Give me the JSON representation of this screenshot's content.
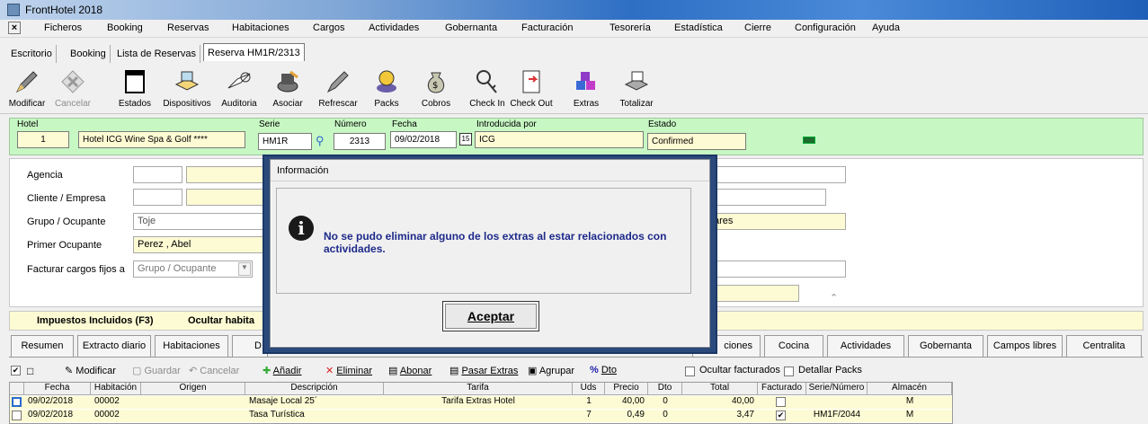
{
  "app": {
    "title": "FrontHotel 2018"
  },
  "menu": [
    "Ficheros",
    "Booking",
    "Reservas",
    "Habitaciones",
    "Cargos",
    "Actividades",
    "Gobernanta",
    "Facturación",
    "Tesorería",
    "Estadística",
    "Cierre",
    "Configuración",
    "Ayuda"
  ],
  "nav_tabs": [
    "Escritorio",
    "Booking",
    "Lista de Reservas",
    "Reserva HM1R/2313"
  ],
  "toolbar": [
    {
      "label": "Modificar",
      "icon": "edit-pencil-icon"
    },
    {
      "label": "Cancelar",
      "icon": "cancel-x-icon"
    },
    {
      "label": "Estados",
      "icon": "window-icon"
    },
    {
      "label": "Dispositivos",
      "icon": "devices-icon"
    },
    {
      "label": "Auditoria",
      "icon": "book-icon"
    },
    {
      "label": "Asociar",
      "icon": "associate-icon"
    },
    {
      "label": "Refrescar",
      "icon": "refresh-icon"
    },
    {
      "label": "Packs",
      "icon": "packs-icon"
    },
    {
      "label": "Cobros",
      "icon": "money-bag-icon"
    },
    {
      "label": "Check In",
      "icon": "key-icon"
    },
    {
      "label": "Check Out",
      "icon": "checkout-icon"
    },
    {
      "label": "Extras",
      "icon": "cubes-icon"
    },
    {
      "label": "Totalizar",
      "icon": "printer-icon"
    }
  ],
  "header": {
    "hotel_label": "Hotel",
    "hotel_code": "1",
    "hotel_name": "Hotel ICG Wine Spa & Golf ****",
    "serie_label": "Serie",
    "serie": "HM1R",
    "numero_label": "Número",
    "numero": "2313",
    "fecha_label": "Fecha",
    "fecha": "09/02/2018",
    "cal_day": "15",
    "introducida_label": "Introducida por",
    "introducida": "ICG",
    "estado_label": "Estado",
    "estado": "Confirmed"
  },
  "form": {
    "agencia_label": "Agencia",
    "cliente_label": "Cliente / Empresa",
    "grupo_label": "Grupo / Ocupante",
    "grupo_value": "Toje",
    "primer_label": "Primer Ocupante",
    "primer_value": "Perez , Abel",
    "facturar_label": "Facturar cargos fijos a",
    "facturar_value": "Grupo / Ocupante",
    "right_value": "ares"
  },
  "section": {
    "impuestos": "Impuestos Incluidos (F3)",
    "ocultar": "Ocultar habita"
  },
  "detail_tabs_left": [
    "Resumen",
    "Extracto diario",
    "Habitaciones",
    "D"
  ],
  "detail_tabs_right": [
    "ciones",
    "Cocina",
    "Actividades",
    "Gobernanta",
    "Campos libres",
    "Centralita"
  ],
  "actions": {
    "modificar": "Modificar",
    "guardar": "Guardar",
    "cancelar": "Cancelar",
    "anadir": "Añadir",
    "eliminar": "Eliminar",
    "abonar": "Abonar",
    "pasar": "Pasar Extras",
    "agrupar": "Agrupar",
    "dto": "Dto",
    "ocultar_facturados": "Ocultar facturados",
    "detallar_packs": "Detallar Packs"
  },
  "grid": {
    "headers": [
      "Fecha",
      "Habitación",
      "Origen",
      "Descripción",
      "Tarifa",
      "Uds",
      "Precio",
      "Dto",
      "Total",
      "Facturado",
      "Serie/Número",
      "Almacén"
    ],
    "rows": [
      {
        "fecha": "09/02/2018",
        "habitacion": "00002",
        "origen": "",
        "descripcion": "Masaje Local 25´",
        "tarifa": "Tarifa Extras Hotel",
        "uds": "1",
        "precio": "40,00",
        "dto": "0",
        "total": "40,00",
        "facturado": false,
        "serie": "",
        "almacen": "M"
      },
      {
        "fecha": "09/02/2018",
        "habitacion": "00002",
        "origen": "",
        "descripcion": "Tasa Turística",
        "tarifa": "",
        "uds": "7",
        "precio": "0,49",
        "dto": "0",
        "total": "3,47",
        "facturado": true,
        "serie": "HM1F/2044",
        "almacen": "M"
      }
    ]
  },
  "dialog": {
    "title": "Información",
    "message": "No se pudo eliminar alguno de los extras al estar relacionados con actividades.",
    "ok": "Aceptar",
    "icon": "info-icon"
  }
}
